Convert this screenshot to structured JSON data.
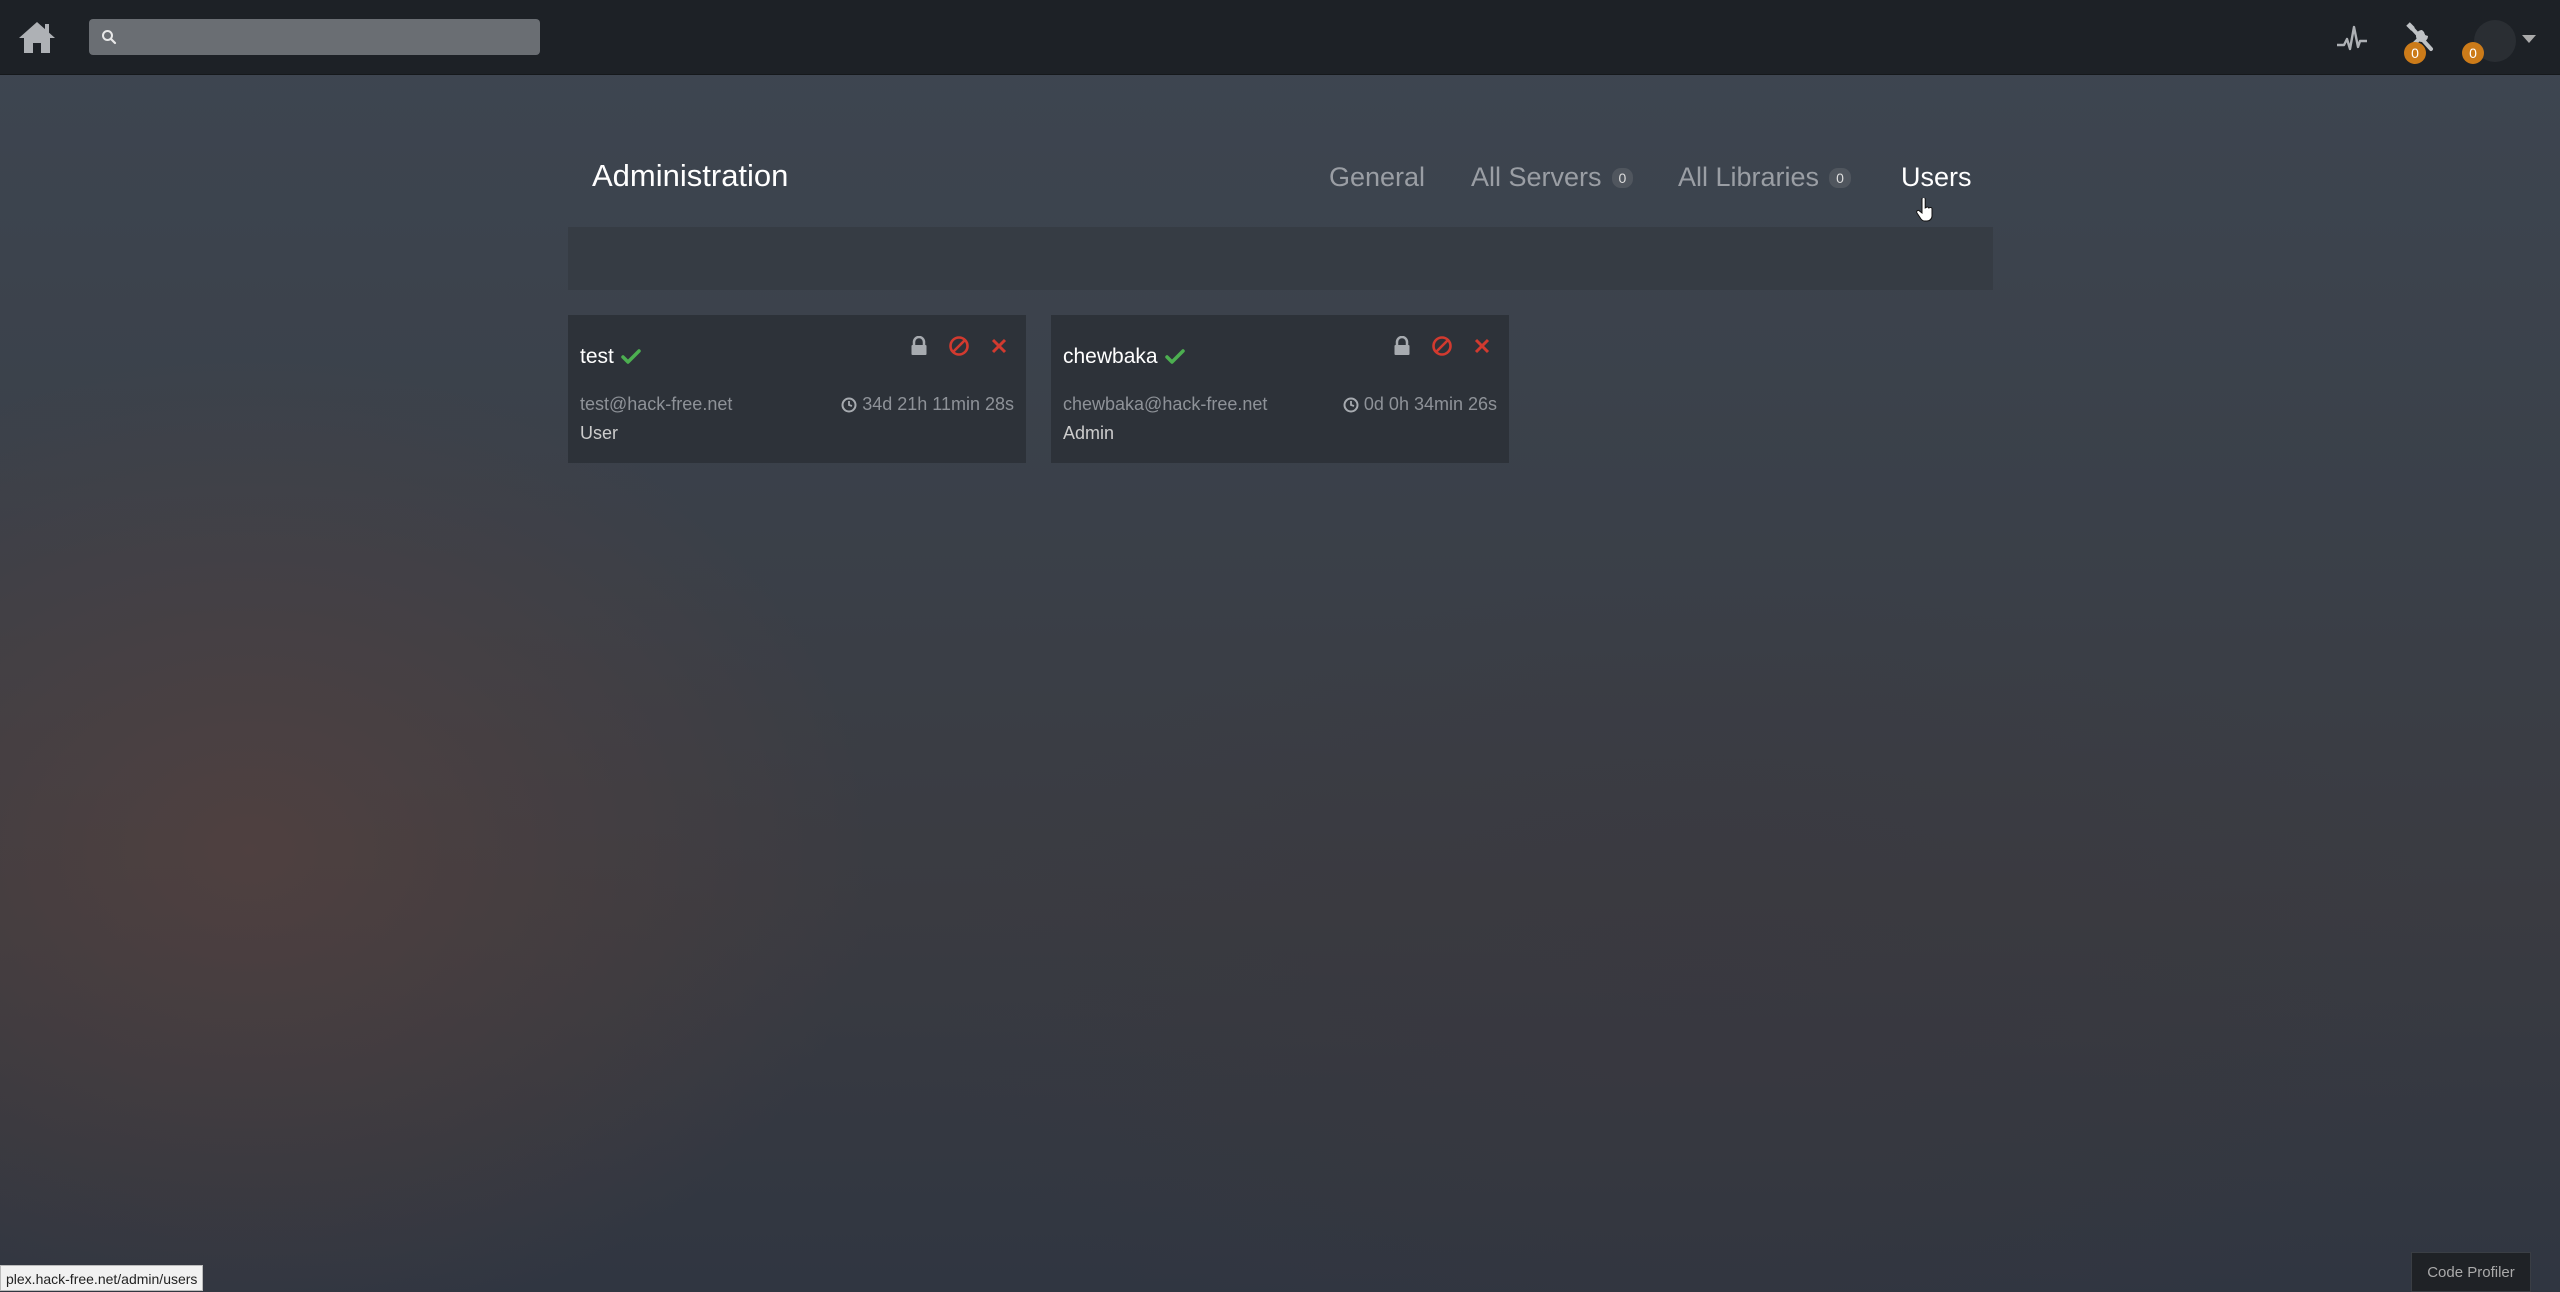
{
  "topbar": {
    "search": {
      "value": "",
      "placeholder": ""
    },
    "activity_icon": "activity-icon",
    "settings_badge": "0",
    "user_badge": "0"
  },
  "admin": {
    "title": "Administration",
    "tabs": [
      {
        "label": "General",
        "badge": null
      },
      {
        "label": "All Servers",
        "badge": "0"
      },
      {
        "label": "All Libraries",
        "badge": "0"
      },
      {
        "label": "Users",
        "badge": null,
        "active": true
      }
    ]
  },
  "users": [
    {
      "name": "test",
      "email": "test@hack-free.net",
      "duration": "34d 21h 11min 28s",
      "role": "User"
    },
    {
      "name": "chewbaka",
      "email": "chewbaka@hack-free.net",
      "duration": "0d 0h 34min 26s",
      "role": "Admin"
    }
  ],
  "status_bar": {
    "url": "plex.hack-free.net/admin/users"
  },
  "code_profiler": {
    "label": "Code Profiler"
  },
  "colors": {
    "topbar": "#1d2126",
    "badge_orange": "#cc7b19",
    "check_green": "#4caf50",
    "danger_red": "#d23a2f",
    "card_bg": "#2d3239"
  }
}
